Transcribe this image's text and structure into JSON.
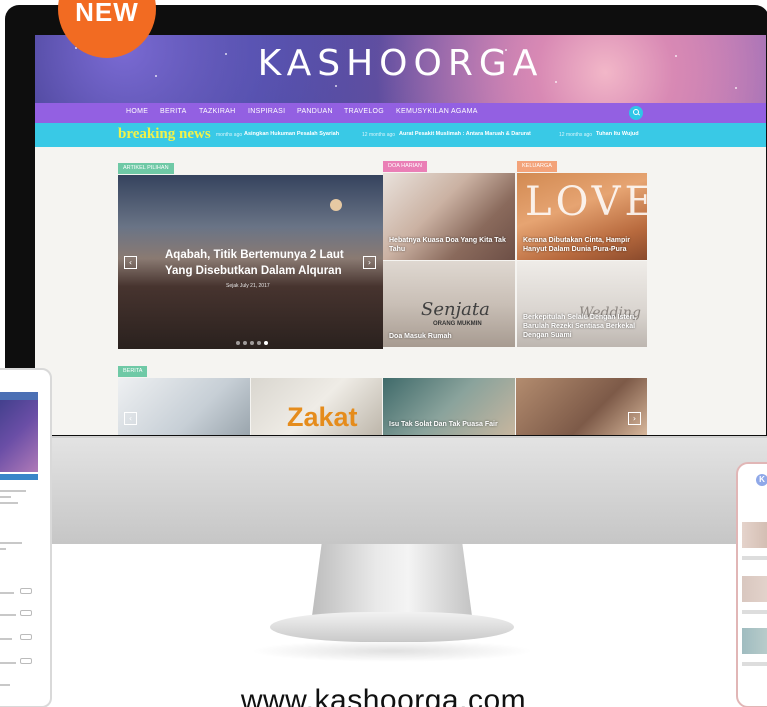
{
  "badge": {
    "label": "NEW"
  },
  "site": {
    "logo": "KASHOORGA",
    "nav": [
      "HOME",
      "BERITA",
      "TAZKIRAH",
      "INSPIRASI",
      "PANDUAN",
      "TRAVELOG",
      "KEMUSYKILAN AGAMA"
    ],
    "breaking_label": "breaking news",
    "ticker": [
      {
        "time": "months ago",
        "title": "Asingkan Hukuman Pesalah Syariah"
      },
      {
        "time": "12 months ago",
        "title": "Aurat Pesakit Muslimah : Antara Maruah & Darurat"
      },
      {
        "time": "12 months ago",
        "title": "Tuhan Itu Wujud"
      }
    ],
    "featured": {
      "tag": "ARTIKEL PILIHAN",
      "title": "Aqabah, Titik Bertemunya 2 Laut Yang Disebutkan Dalam Alquran",
      "meta": "Sejak July 21, 2017",
      "prev": "‹",
      "next": "›"
    },
    "tiles": [
      {
        "tag": "DOA HARIAN",
        "caption": "Hebatnya Kuasa Doa Yang Kita Tak Tahu"
      },
      {
        "tag": "KELUARGA",
        "caption": "Kerana Dibutakan Cinta, Hampir Hanyut Dalam Dunia Pura-Pura"
      },
      {
        "caption": "Doa Masuk Rumah",
        "overlay": "Senjata",
        "overlay2": "ORANG MUKMIN"
      },
      {
        "caption": "Berkepitulah Selalu Dengan Isteri, Barulah Rezeki Sentiasa Berkekal Dengan Suami",
        "overlay": "Wedding"
      }
    ],
    "berita": {
      "tag": "BERITA",
      "zakat": "Zakat",
      "caption": "Isu Tak Solat Dan Tak Puasa Fair",
      "prev": "‹",
      "next": "›"
    }
  },
  "phone": {
    "logo": "K"
  },
  "url": "www.kashoorga.com",
  "colors": {
    "badge": "#f26b22",
    "nav": "#9360e2",
    "ticker": "#39c9e6",
    "breaking": "#f2f249",
    "tag_green": "#6fc9a6",
    "tag_pink": "#ea7fb6",
    "tag_orange": "#f3a37a"
  }
}
